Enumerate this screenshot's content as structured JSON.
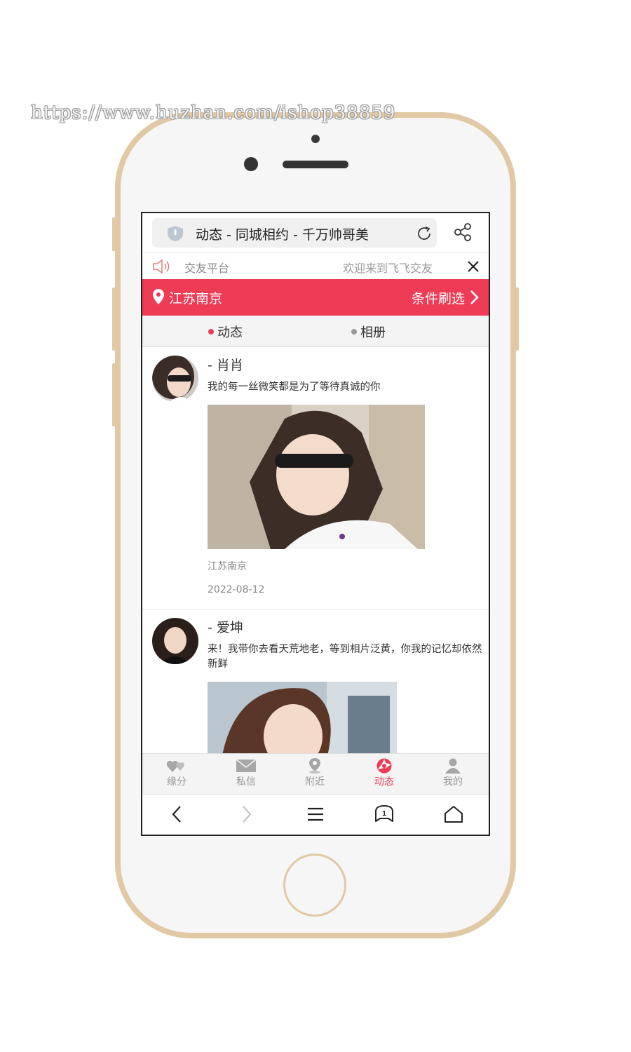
{
  "watermark": "https://www.huzhan.com/ishop38859",
  "browser_top": {
    "title": "动态 - 同城相约 - 千万帅哥美",
    "icons": [
      "shield-icon",
      "reload-icon",
      "share-icon"
    ]
  },
  "notice": {
    "left_text": "交友平台",
    "right_text": "欢迎来到飞飞交友",
    "icons": [
      "speaker-icon",
      "close-icon"
    ]
  },
  "location_bar": {
    "location": "江苏南京",
    "filter_label": "条件刷选",
    "color": "#ee3b56"
  },
  "tabs": [
    {
      "label": "动态",
      "active": true
    },
    {
      "label": "相册",
      "active": false
    }
  ],
  "posts": [
    {
      "name": "- 肖肖",
      "text": "我的每一丝微笑都是为了等待真诚的你",
      "location": "江苏南京",
      "date": "2022-08-12"
    },
    {
      "name": "- 爱坤",
      "text": "来！我带你去看天荒地老，等到相片泛黄，你我的记忆却依然新鲜"
    }
  ],
  "bottom_tabs": [
    {
      "label": "缘分",
      "icon": "hearts-icon",
      "active": false
    },
    {
      "label": "私信",
      "icon": "envelope-icon",
      "active": false
    },
    {
      "label": "附近",
      "icon": "location-pin-icon",
      "active": false
    },
    {
      "label": "动态",
      "icon": "aperture-icon",
      "active": true
    },
    {
      "label": "我的",
      "icon": "person-icon",
      "active": false
    }
  ],
  "browser_nav": {
    "tab_count": "1",
    "icons": [
      "back-icon",
      "forward-icon",
      "menu-icon",
      "tabs-icon",
      "home-icon"
    ]
  },
  "colors": {
    "accent": "#ee3b56",
    "phone_frame": "#e1c9a5"
  }
}
